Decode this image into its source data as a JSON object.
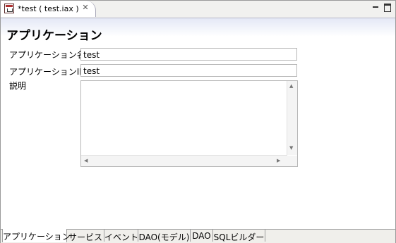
{
  "editor_tab": {
    "title": "*test ( test.iax )",
    "close_glyph": "✕"
  },
  "page_title": "アプリケーション",
  "form": {
    "app_name_label": "アプリケーション名",
    "app_name_value": "test",
    "app_id_label": "アプリケーションID",
    "app_id_value": "test",
    "description_label": "説明",
    "description_value": ""
  },
  "bottom_tabs": [
    {
      "label": "アプリケーション",
      "active": true
    },
    {
      "label": "サービス"
    },
    {
      "label": "イベント"
    },
    {
      "label": "DAO(モデル)"
    },
    {
      "label": "DAO"
    },
    {
      "label": "SQLビルダー"
    }
  ],
  "icons": {
    "editor": "application-editor-icon",
    "close": "close-icon",
    "minimize": "minimize-icon",
    "maximize": "maximize-icon"
  }
}
